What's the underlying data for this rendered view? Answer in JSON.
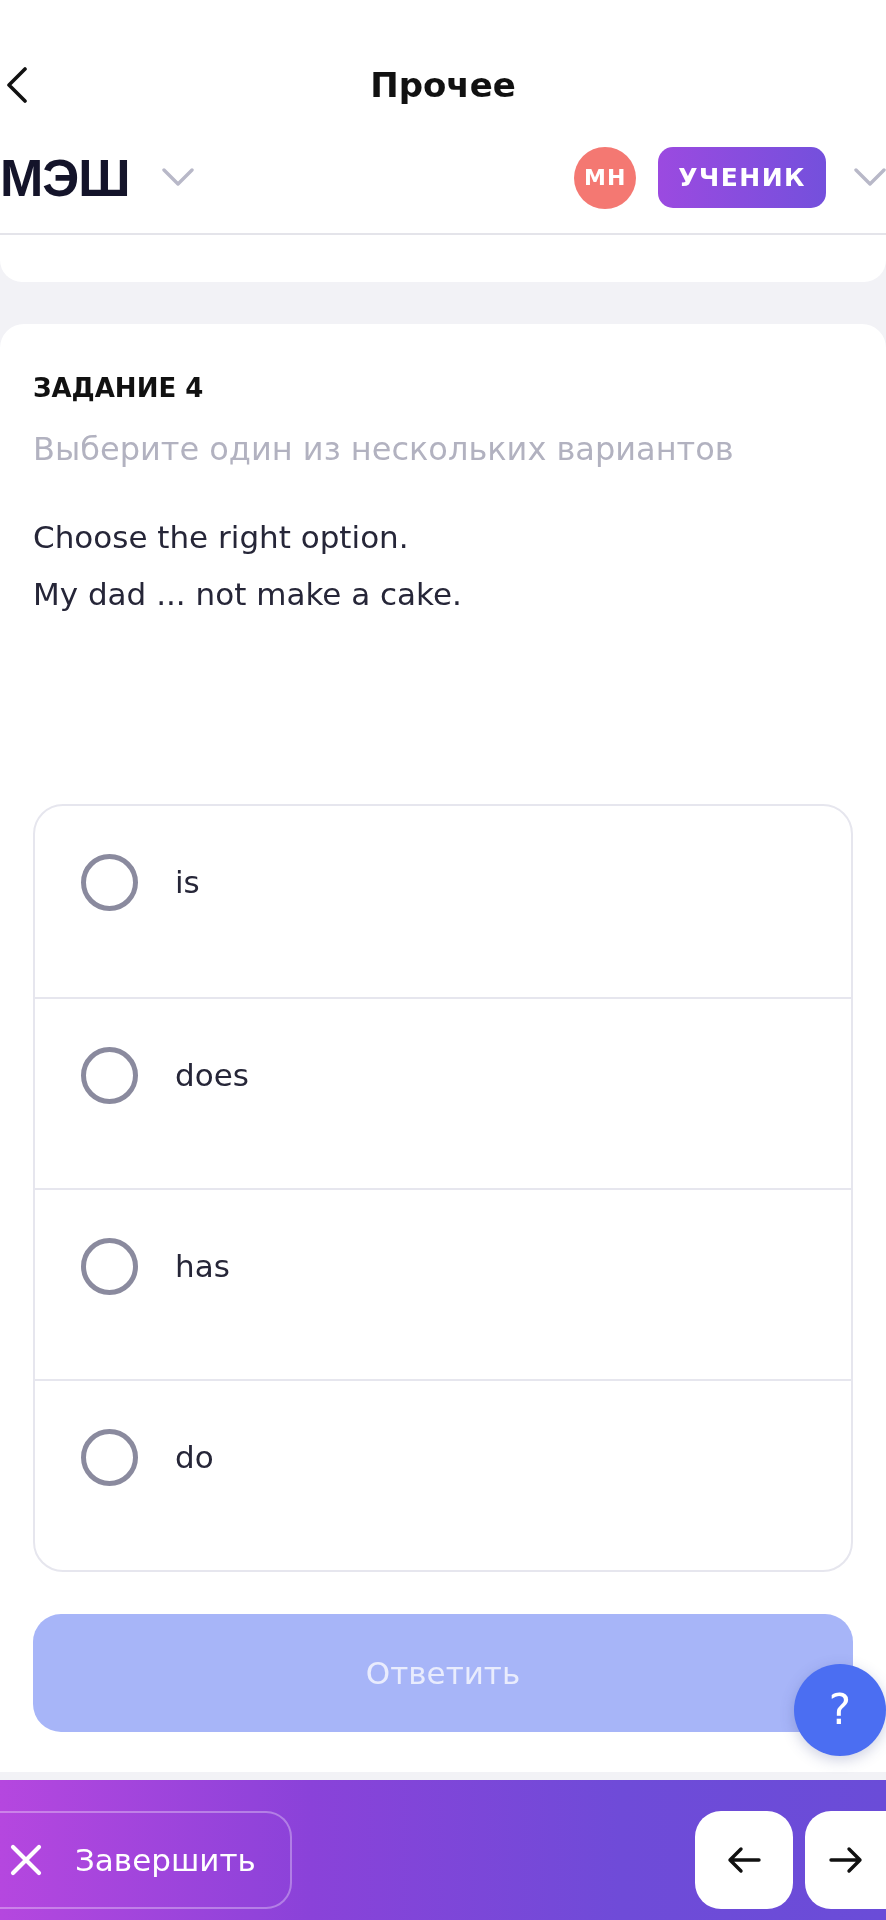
{
  "top_bar": {
    "title": "Прочее"
  },
  "header": {
    "logo": "МЭШ",
    "avatar": "МН",
    "role": "УЧЕНИК"
  },
  "task": {
    "heading": "ЗАДАНИЕ 4",
    "instruction": "Выберите один из нескольких вариантов",
    "question_lines": [
      "Choose the right option.",
      "My dad ... not make a cake."
    ]
  },
  "options": [
    {
      "label": "is",
      "selected": false
    },
    {
      "label": "does",
      "selected": false
    },
    {
      "label": "has",
      "selected": false
    },
    {
      "label": "do",
      "selected": false
    }
  ],
  "answer_button": {
    "label": "Ответить",
    "disabled": true
  },
  "help_button": {
    "label": "?"
  },
  "bottom_bar": {
    "finish_button": {
      "label": "Завершить"
    }
  }
}
